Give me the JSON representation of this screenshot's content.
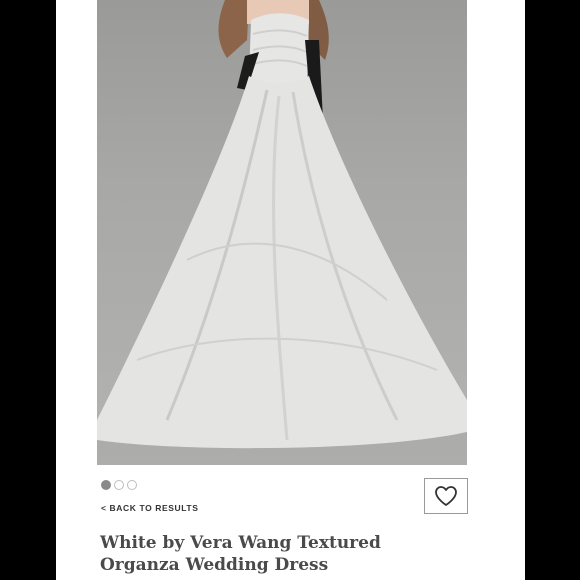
{
  "product": {
    "image_icon": "wedding-dress-photo",
    "gallery_dot_count": 3,
    "gallery_active_index": 0,
    "back_link": "< BACK TO RESULTS",
    "title": "White by Vera Wang Textured\nOrganza Wedding Dress",
    "wishlist_icon": "heart-outline-icon"
  },
  "colors": {
    "background": "#000000",
    "card": "#ffffff",
    "dot_active": "#8a8a8a",
    "title_text": "#4a4a4a"
  }
}
